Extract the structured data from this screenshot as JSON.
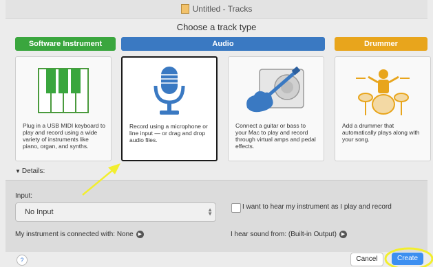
{
  "window": {
    "title": "Untitled - Tracks"
  },
  "dialog": {
    "heading": "Choose a track type",
    "categories": [
      {
        "label": "Software Instrument",
        "color": "#3aa63e"
      },
      {
        "label": "Audio",
        "color": "#3a79c2"
      },
      {
        "label": "Drummer",
        "color": "#e8a51c"
      }
    ],
    "cards": [
      {
        "description": "Plug in a USB MIDI keyboard to play and record using a wide variety of instruments like piano, organ, and synths.",
        "icon": "piano-keyboard-icon"
      },
      {
        "description": "Record using a microphone or line input — or drag and drop audio files.",
        "icon": "microphone-icon"
      },
      {
        "description": "Connect a guitar or bass to your Mac to play and record through virtual amps and pedal effects.",
        "icon": "guitar-amp-icon"
      },
      {
        "description": "Add a drummer that automatically plays along with your song.",
        "icon": "drummer-icon"
      }
    ],
    "details_label": "Details:",
    "input": {
      "label": "Input:",
      "value": "No Input"
    },
    "hear_instrument_label": "I want to hear my instrument as I play and record",
    "connected_label": "My instrument is connected with: None",
    "hear_from_label": "I hear sound from: (Built-in Output)",
    "buttons": {
      "help": "?",
      "cancel": "Cancel",
      "create": "Create"
    }
  },
  "annotations": {
    "highlight_color": "#f2ee2e"
  }
}
